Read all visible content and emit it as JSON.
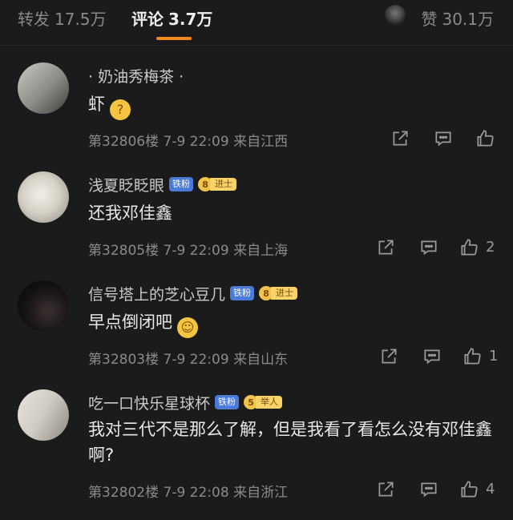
{
  "header": {
    "repost_label": "转发",
    "repost_count": "17.5万",
    "comments_label": "评论",
    "comments_count": "3.7万",
    "likes_label": "赞",
    "likes_count": "30.1万",
    "accent_color": "#f28a1e"
  },
  "comments": [
    {
      "name": "· 奶油秀梅茶 ·",
      "text": "虾",
      "emoji": "surprised-face",
      "floor": "第32806楼",
      "time": "7-9 22:09",
      "location": "来自江西",
      "likes": ""
    },
    {
      "name": "浅夏眨眨眼",
      "fan_badge": "铁粉",
      "rank_level": "8",
      "rank_title": "进士",
      "text": "还我邓佳鑫",
      "floor": "第32805楼",
      "time": "7-9 22:09",
      "location": "来自上海",
      "likes": "2"
    },
    {
      "name": "信号塔上的芝心豆几",
      "fan_badge": "铁粉",
      "rank_level": "8",
      "rank_title": "进士",
      "text": "早点倒闭吧",
      "emoji": "smile-face",
      "floor": "第32803楼",
      "time": "7-9 22:09",
      "location": "来自山东",
      "likes": "1"
    },
    {
      "name": "吃一口快乐星球杯",
      "fan_badge": "铁粉",
      "rank_level": "5",
      "rank_title": "举人",
      "text": "我对三代不是那么了解，但是我看了看怎么没有邓佳鑫啊?",
      "floor": "第32802楼",
      "time": "7-9 22:08",
      "location": "来自浙江",
      "likes": "4"
    }
  ]
}
